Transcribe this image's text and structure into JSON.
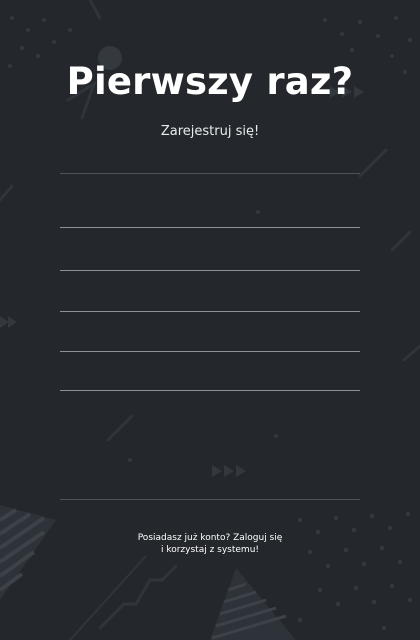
{
  "colors": {
    "background": "#24282d",
    "text": "#ffffff",
    "field_underline": "#8b9198",
    "decoration": "#3a3f45"
  },
  "register": {
    "title": "Pierwszy raz?",
    "subtitle": "Zarejestruj się!",
    "fields": [
      {
        "name": "field-1",
        "value": "",
        "placeholder": ""
      },
      {
        "name": "field-2",
        "value": "",
        "placeholder": ""
      },
      {
        "name": "field-3",
        "value": "",
        "placeholder": ""
      },
      {
        "name": "field-4",
        "value": "",
        "placeholder": ""
      },
      {
        "name": "field-5",
        "value": "",
        "placeholder": ""
      }
    ],
    "login_hint_line1": "Posiadasz już konto? Zaloguj się",
    "login_hint_line2": "i korzystaj z systemu!"
  }
}
